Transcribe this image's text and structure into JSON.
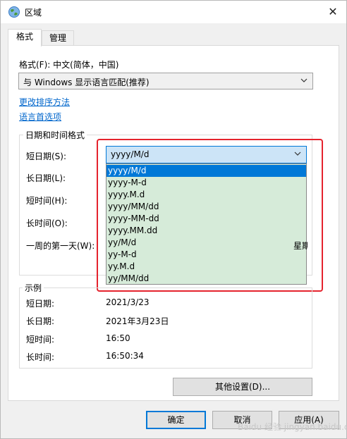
{
  "window": {
    "title": "区域",
    "close_glyph": "✕"
  },
  "tabs": [
    {
      "label": "格式"
    },
    {
      "label": "管理"
    }
  ],
  "format": {
    "label": "格式(F): 中文(简体，中国)",
    "value": "与 Windows 显示语言匹配(推荐)"
  },
  "links": {
    "sort": "更改排序方法",
    "language": "语言首选项"
  },
  "datetime": {
    "group_title": "日期和时间格式",
    "short_date_label": "短日期(S):",
    "short_date_value": "yyyy/M/d",
    "long_date_label": "长日期(L):",
    "short_time_label": "短时间(H):",
    "long_time_label": "长时间(O):",
    "first_day_label": "一周的第一天(W):",
    "hidden_value_fragment": "星期日"
  },
  "dropdown": {
    "options": [
      "yyyy/M/d",
      "yyyy-M-d",
      "yyyy.M.d",
      "yyyy/MM/dd",
      "yyyy-MM-dd",
      "yyyy.MM.dd",
      "yy/M/d",
      "yy-M-d",
      "yy.M.d",
      "yy/MM/dd"
    ],
    "selected_index": 0,
    "highlight_color": "#0078d7",
    "list_bg_color": "#d6ebd9"
  },
  "examples": {
    "group_title": "示例",
    "rows": [
      {
        "label": "短日期:",
        "value": "2021/3/23"
      },
      {
        "label": "长日期:",
        "value": "2021年3月23日"
      },
      {
        "label": "短时间:",
        "value": "16:50"
      },
      {
        "label": "长时间:",
        "value": "16:50:34"
      }
    ]
  },
  "buttons": {
    "other_settings": "其他设置(D)...",
    "ok": "确定",
    "cancel": "取消",
    "apply": "应用(A)"
  },
  "annotation_color": "#e5232d",
  "watermark_text": "Baidu 经验 jingyan.baidu.com"
}
